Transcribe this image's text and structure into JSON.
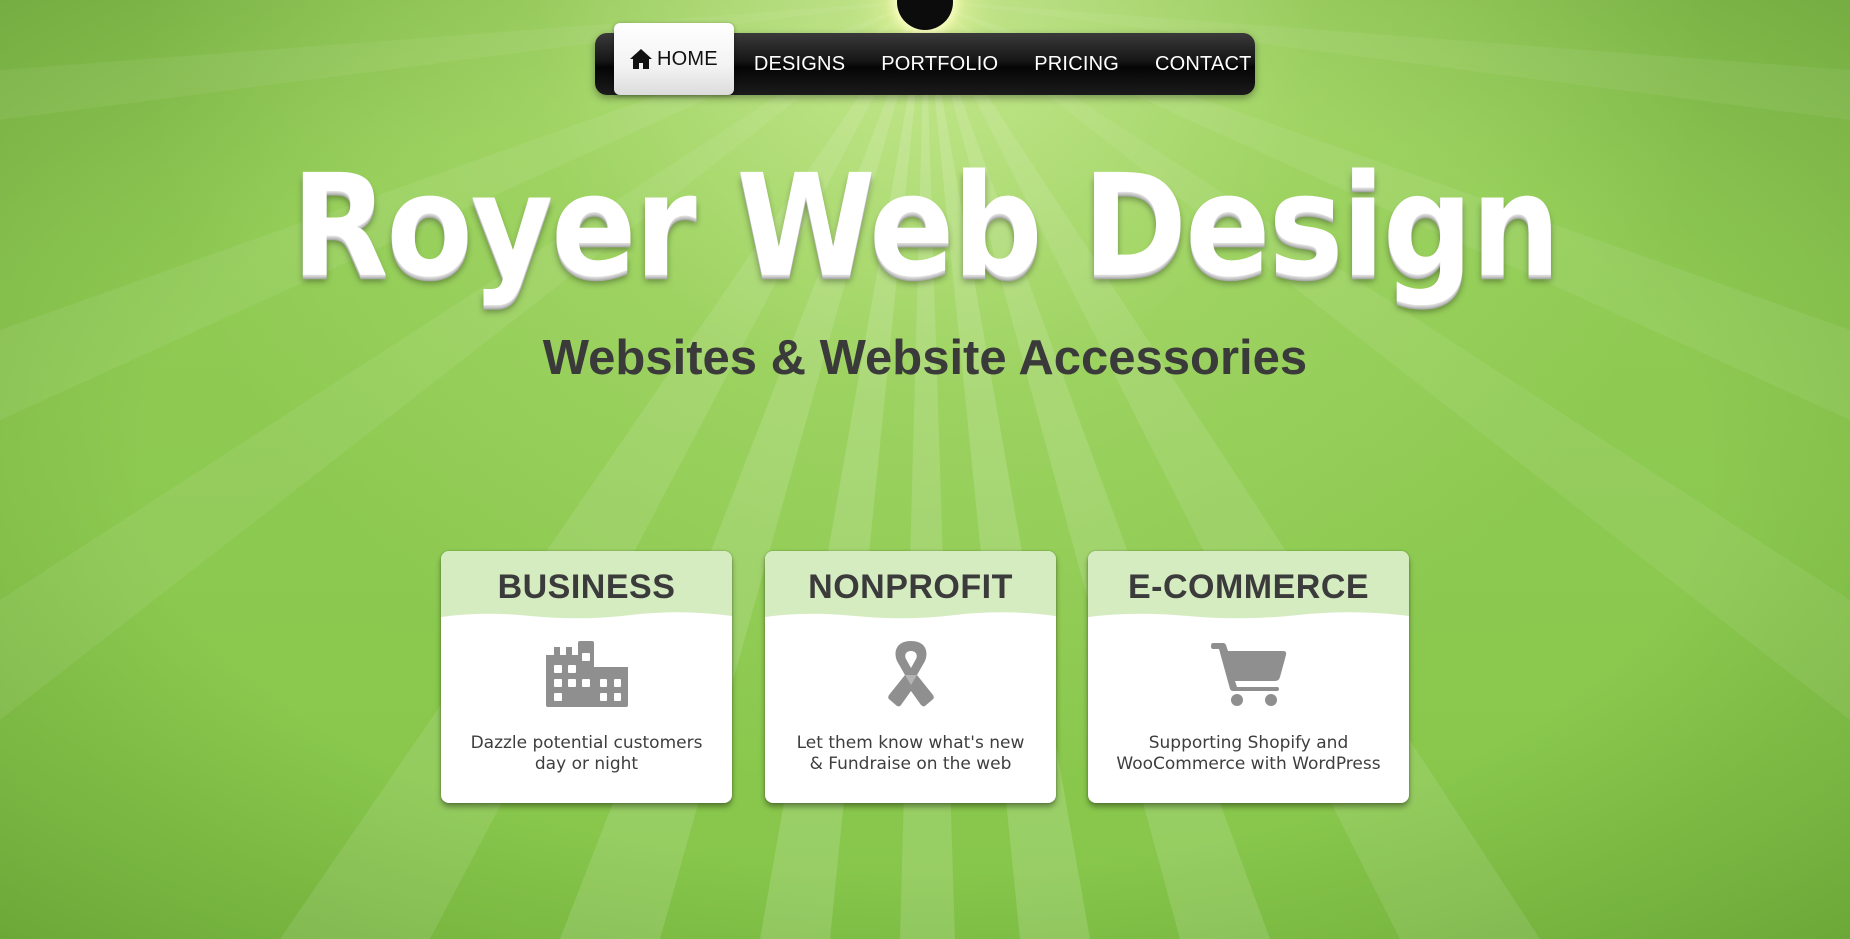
{
  "nav": {
    "items": [
      {
        "label": "HOME",
        "icon": "home-icon",
        "active": true
      },
      {
        "label": "DESIGNS"
      },
      {
        "label": "PORTFOLIO"
      },
      {
        "label": "PRICING"
      },
      {
        "label": "CONTACT"
      }
    ]
  },
  "hero": {
    "title": "Royer Web Design",
    "subtitle": "Websites & Website Accessories"
  },
  "cards": [
    {
      "heading": "BUSINESS",
      "icon": "building-icon",
      "text": "Dazzle potential customers\nday or night"
    },
    {
      "heading": "NONPROFIT",
      "icon": "ribbon-icon",
      "text": "Let them know what's new\n& Fundraise on the web"
    },
    {
      "heading": "E-COMMERCE",
      "icon": "shopping-cart-icon",
      "text": "Supporting Shopify and\nWooCommerce with WordPress"
    }
  ],
  "colors": {
    "background": "#8bc84f",
    "card_header": "#d5ebc0",
    "text_dark": "#3a3a3a",
    "icon_gray": "#8f8f8f",
    "nav_bg": "#111111"
  }
}
